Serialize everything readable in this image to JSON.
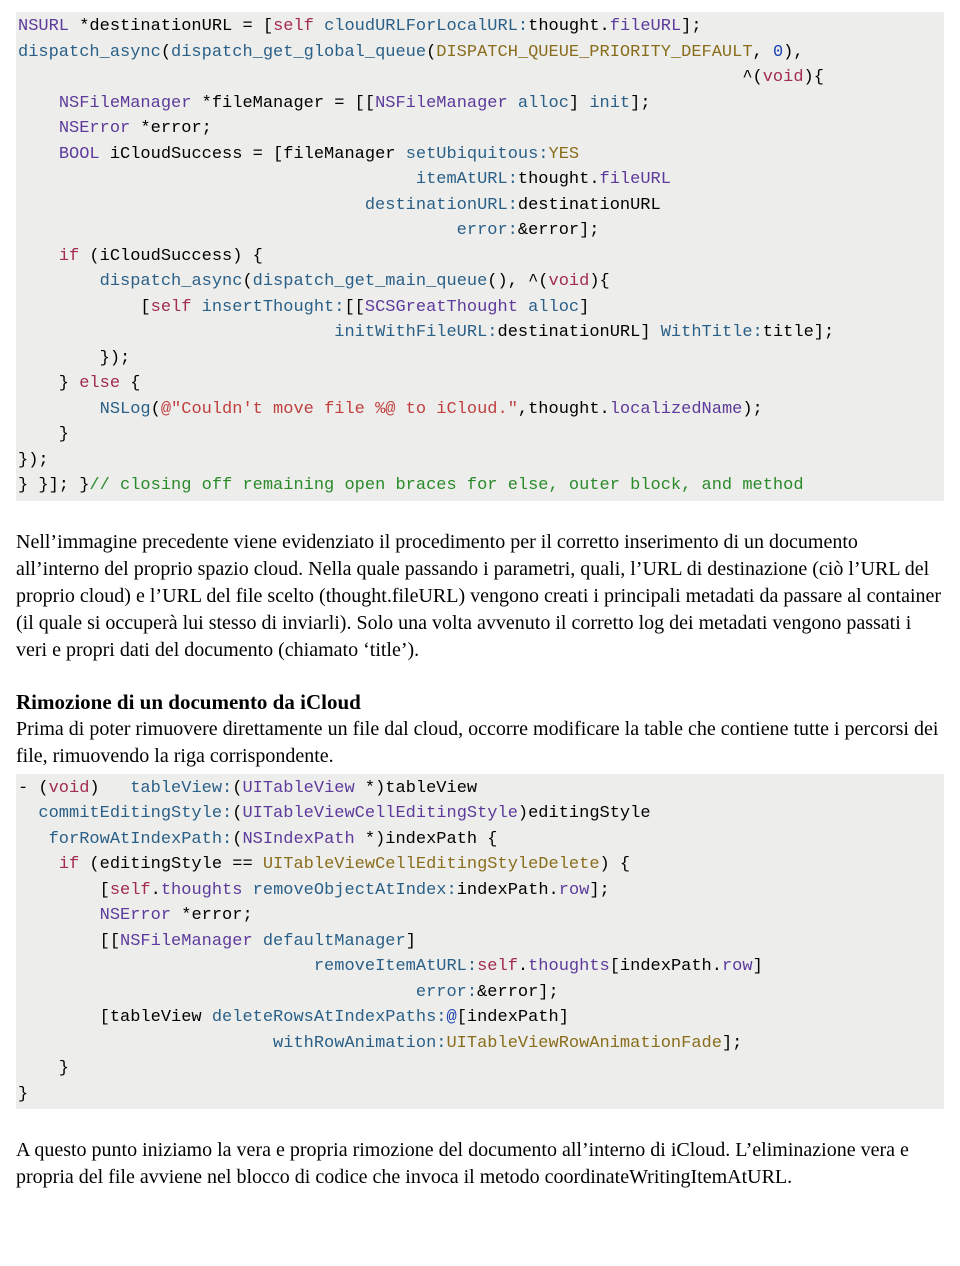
{
  "code1_lines": [
    "<span class='t-type'>NSURL</span> *destinationURL = [<span class='t-kw'>self</span> <span class='t-func'>cloudURLForLocalURL:</span>thought.<span class='t-prop'>fileURL</span>];",
    "<span class='t-func'>dispatch_async</span>(<span class='t-func'>dispatch_get_global_queue</span>(<span class='t-const'>DISPATCH_QUEUE_PRIORITY_DEFAULT</span>, <span class='t-num'>0</span>),",
    "                                                                       ^(<span class='t-kw'>void</span>){",
    "    <span class='t-type'>NSFileManager</span> *fileManager = [[<span class='t-type'>NSFileManager</span> <span class='t-func'>alloc</span>] <span class='t-func'>init</span>];",
    "    <span class='t-type'>NSError</span> *error;",
    "    <span class='t-type'>BOOL</span> iCloudSuccess = [fileManager <span class='t-func'>setUbiquitous:</span><span class='t-const'>YES</span>",
    "                                       <span class='t-func'>itemAtURL:</span>thought.<span class='t-prop'>fileURL</span>",
    "                                  <span class='t-func'>destinationURL:</span>destinationURL",
    "                                           <span class='t-func'>error:</span>&amp;error];",
    "    <span class='t-kw'>if</span> (iCloudSuccess) {",
    "        <span class='t-func'>dispatch_async</span>(<span class='t-func'>dispatch_get_main_queue</span>(), ^(<span class='t-kw'>void</span>){",
    "            [<span class='t-kw'>self</span> <span class='t-func'>insertThought:</span>[[<span class='t-type'>SCSGreatThought</span> <span class='t-func'>alloc</span>]",
    "                               <span class='t-func'>initWithFileURL:</span>destinationURL] <span class='t-func'>WithTitle:</span>title];",
    "        });",
    "    } <span class='t-kw'>else</span> {",
    "        <span class='t-func'>NSLog</span>(<span class='t-str'>@\"Couldn't move file %@ to iCloud.\"</span>,thought.<span class='t-prop'>localizedName</span>);",
    "    }",
    "});",
    "} }]; }<span class='t-comm'>// closing off remaining open braces for else, outer block, and method</span>"
  ],
  "para1": "Nell’immagine precedente viene evidenziato il procedimento per il corretto inserimento di un documento all’interno del proprio spazio cloud. Nella quale passando i parametri, quali, l’URL di destinazione (ciò l’URL del proprio cloud) e l’URL del file scelto (thought.fileURL) vengono creati i principali metadati da passare al container (il quale si occuperà lui stesso di inviarli). Solo una volta avvenuto il corretto log dei metadati vengono passati i veri e propri dati del documento (chiamato ‘title’).",
  "heading2": "Rimozione di un documento da iCloud",
  "para2": "Prima di poter rimuovere direttamente un file dal cloud, occorre modificare la table che contiene tutte i percorsi dei file, rimuovendo la riga corrispondente.",
  "code2_lines": [
    "- (<span class='t-kw'>void</span>)   <span class='t-func'>tableView:</span>(<span class='t-type'>UITableView</span> *)tableView",
    "  <span class='t-func'>commitEditingStyle:</span>(<span class='t-type'>UITableViewCellEditingStyle</span>)editingStyle",
    "   <span class='t-func'>forRowAtIndexPath:</span>(<span class='t-type'>NSIndexPath</span> *)indexPath {",
    "    <span class='t-kw'>if</span> (editingStyle == <span class='t-const'>UITableViewCellEditingStyleDelete</span>) {",
    "        [<span class='t-kw'>self</span>.<span class='t-prop'>thoughts</span> <span class='t-func'>removeObjectAtIndex:</span>indexPath.<span class='t-prop'>row</span>];",
    "        <span class='t-type'>NSError</span> *error;",
    "        [[<span class='t-type'>NSFileManager</span> <span class='t-func'>defaultManager</span>]",
    "                             <span class='t-func'>removeItemAtURL:</span><span class='t-kw'>self</span>.<span class='t-prop'>thoughts</span>[indexPath.<span class='t-prop'>row</span>]",
    "                                       <span class='t-func'>error:</span>&amp;error];",
    "        [tableView <span class='t-func'>deleteRowsAtIndexPaths:</span><span class='t-num'>@</span>[indexPath]",
    "                         <span class='t-func'>withRowAnimation:</span><span class='t-const'>UITableViewRowAnimationFade</span>];",
    "    }",
    "}"
  ],
  "para3": "A questo punto iniziamo la vera e propria rimozione del documento all’interno di iCloud. L’eliminazione vera e propria del file avviene nel blocco di codice che invoca il metodo coordinateWritingItemAtURL."
}
